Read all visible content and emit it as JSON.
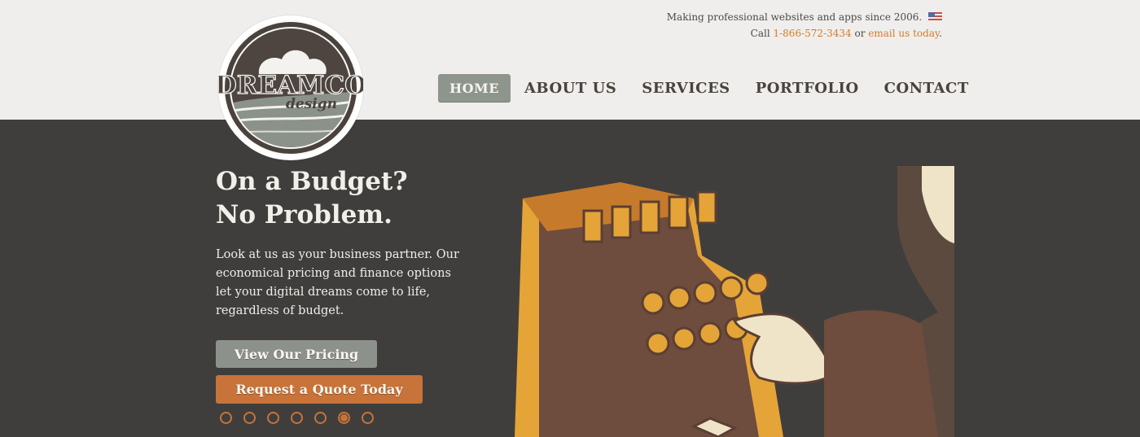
{
  "header": {
    "tagline": "Making professional websites and apps since 2006.",
    "flag_icon": "us-flag-icon",
    "contact_prefix": "Call",
    "phone": "1-866-572-3434",
    "contact_middle": "or",
    "email_link": "email us today",
    "contact_suffix": "."
  },
  "logo": {
    "name": "DREAMCO",
    "sub": "design"
  },
  "nav": {
    "items": [
      {
        "label": "HOME",
        "active": true
      },
      {
        "label": "ABOUT US"
      },
      {
        "label": "SERVICES"
      },
      {
        "label": "PORTFOLIO"
      },
      {
        "label": "CONTACT"
      }
    ]
  },
  "hero": {
    "title_line1": "On a Budget?",
    "title_line2": "No Problem.",
    "text": "Look at us as your business partner. Our economical pricing and finance options let your digital dreams come to life, regardless of budget.",
    "btn_pricing": "View Our Pricing",
    "btn_quote": "Request a Quote Today"
  },
  "slider": {
    "total": 7,
    "active_index": 5
  },
  "colors": {
    "accent": "#c7733a",
    "nav_active_bg": "#8e958d",
    "hero_bg": "#3f3e3c",
    "header_bg": "#efeeec"
  }
}
